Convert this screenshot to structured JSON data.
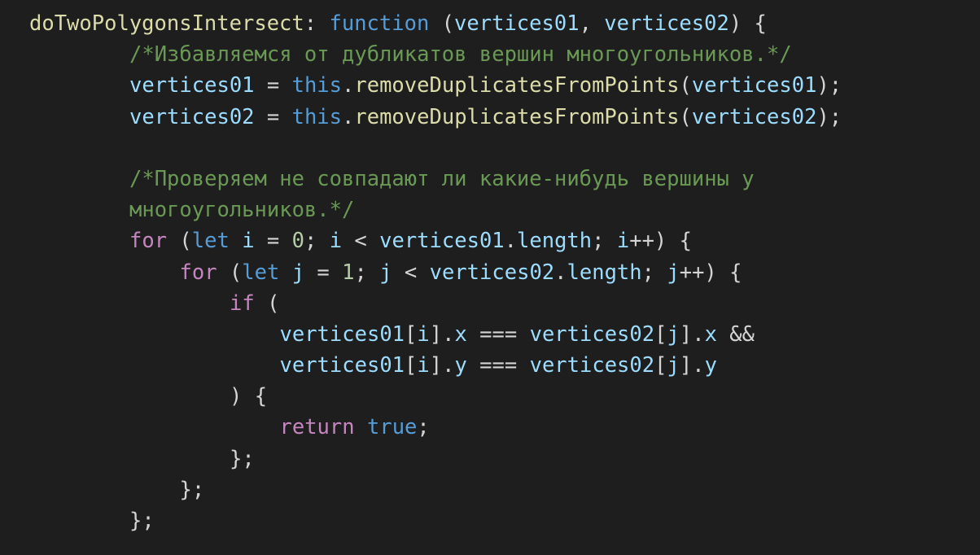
{
  "colors": {
    "background": "#1e1e1e",
    "default": "#d4d4d4",
    "keyword": "#569cd6",
    "control": "#c586c0",
    "variable": "#9cdcfe",
    "function": "#dcdcaa",
    "number": "#b5cea8",
    "comment": "#6a9955"
  },
  "lines": [
    {
      "indent": 0,
      "tokens": [
        {
          "t": "doTwoPolygonsIntersect",
          "k": "function"
        },
        {
          "t": ": ",
          "k": "default"
        },
        {
          "t": "function",
          "k": "keyword"
        },
        {
          "t": " (",
          "k": "default"
        },
        {
          "t": "vertices01",
          "k": "variable"
        },
        {
          "t": ", ",
          "k": "default"
        },
        {
          "t": "vertices02",
          "k": "variable"
        },
        {
          "t": ") {",
          "k": "default"
        }
      ]
    },
    {
      "indent": 2,
      "tokens": [
        {
          "t": "/*Избавляемся от дубликатов вершин многоугольников.*/",
          "k": "comment"
        }
      ]
    },
    {
      "indent": 2,
      "tokens": [
        {
          "t": "vertices01",
          "k": "variable"
        },
        {
          "t": " = ",
          "k": "default"
        },
        {
          "t": "this",
          "k": "keyword"
        },
        {
          "t": ".",
          "k": "default"
        },
        {
          "t": "removeDuplicatesFromPoints",
          "k": "function"
        },
        {
          "t": "(",
          "k": "default"
        },
        {
          "t": "vertices01",
          "k": "variable"
        },
        {
          "t": ");",
          "k": "default"
        }
      ]
    },
    {
      "indent": 2,
      "tokens": [
        {
          "t": "vertices02",
          "k": "variable"
        },
        {
          "t": " = ",
          "k": "default"
        },
        {
          "t": "this",
          "k": "keyword"
        },
        {
          "t": ".",
          "k": "default"
        },
        {
          "t": "removeDuplicatesFromPoints",
          "k": "function"
        },
        {
          "t": "(",
          "k": "default"
        },
        {
          "t": "vertices02",
          "k": "variable"
        },
        {
          "t": ");",
          "k": "default"
        }
      ]
    },
    {
      "indent": 0,
      "tokens": []
    },
    {
      "indent": 2,
      "tokens": [
        {
          "t": "/*Проверяем не совпадают ли какие-нибудь вершины у",
          "k": "comment"
        }
      ]
    },
    {
      "indent": 2,
      "tokens": [
        {
          "t": "многоугольников.*/",
          "k": "comment"
        }
      ]
    },
    {
      "indent": 2,
      "tokens": [
        {
          "t": "for",
          "k": "control"
        },
        {
          "t": " (",
          "k": "default"
        },
        {
          "t": "let",
          "k": "keyword"
        },
        {
          "t": " ",
          "k": "default"
        },
        {
          "t": "i",
          "k": "variable"
        },
        {
          "t": " = ",
          "k": "default"
        },
        {
          "t": "0",
          "k": "number"
        },
        {
          "t": "; ",
          "k": "default"
        },
        {
          "t": "i",
          "k": "variable"
        },
        {
          "t": " < ",
          "k": "default"
        },
        {
          "t": "vertices01",
          "k": "variable"
        },
        {
          "t": ".",
          "k": "default"
        },
        {
          "t": "length",
          "k": "variable"
        },
        {
          "t": "; ",
          "k": "default"
        },
        {
          "t": "i",
          "k": "variable"
        },
        {
          "t": "++) {",
          "k": "default"
        }
      ]
    },
    {
      "indent": 3,
      "tokens": [
        {
          "t": "for",
          "k": "control"
        },
        {
          "t": " (",
          "k": "default"
        },
        {
          "t": "let",
          "k": "keyword"
        },
        {
          "t": " ",
          "k": "default"
        },
        {
          "t": "j",
          "k": "variable"
        },
        {
          "t": " = ",
          "k": "default"
        },
        {
          "t": "1",
          "k": "number"
        },
        {
          "t": "; ",
          "k": "default"
        },
        {
          "t": "j",
          "k": "variable"
        },
        {
          "t": " < ",
          "k": "default"
        },
        {
          "t": "vertices02",
          "k": "variable"
        },
        {
          "t": ".",
          "k": "default"
        },
        {
          "t": "length",
          "k": "variable"
        },
        {
          "t": "; ",
          "k": "default"
        },
        {
          "t": "j",
          "k": "variable"
        },
        {
          "t": "++) {",
          "k": "default"
        }
      ]
    },
    {
      "indent": 4,
      "tokens": [
        {
          "t": "if",
          "k": "control"
        },
        {
          "t": " (",
          "k": "default"
        }
      ]
    },
    {
      "indent": 5,
      "tokens": [
        {
          "t": "vertices01",
          "k": "variable"
        },
        {
          "t": "[",
          "k": "default"
        },
        {
          "t": "i",
          "k": "variable"
        },
        {
          "t": "].",
          "k": "default"
        },
        {
          "t": "x",
          "k": "variable"
        },
        {
          "t": " === ",
          "k": "default"
        },
        {
          "t": "vertices02",
          "k": "variable"
        },
        {
          "t": "[",
          "k": "default"
        },
        {
          "t": "j",
          "k": "variable"
        },
        {
          "t": "].",
          "k": "default"
        },
        {
          "t": "x",
          "k": "variable"
        },
        {
          "t": " &&",
          "k": "default"
        }
      ]
    },
    {
      "indent": 5,
      "tokens": [
        {
          "t": "vertices01",
          "k": "variable"
        },
        {
          "t": "[",
          "k": "default"
        },
        {
          "t": "i",
          "k": "variable"
        },
        {
          "t": "].",
          "k": "default"
        },
        {
          "t": "y",
          "k": "variable"
        },
        {
          "t": " === ",
          "k": "default"
        },
        {
          "t": "vertices02",
          "k": "variable"
        },
        {
          "t": "[",
          "k": "default"
        },
        {
          "t": "j",
          "k": "variable"
        },
        {
          "t": "].",
          "k": "default"
        },
        {
          "t": "y",
          "k": "variable"
        }
      ]
    },
    {
      "indent": 4,
      "tokens": [
        {
          "t": ") {",
          "k": "default"
        }
      ]
    },
    {
      "indent": 5,
      "tokens": [
        {
          "t": "return",
          "k": "control"
        },
        {
          "t": " ",
          "k": "default"
        },
        {
          "t": "true",
          "k": "keyword"
        },
        {
          "t": ";",
          "k": "default"
        }
      ]
    },
    {
      "indent": 4,
      "tokens": [
        {
          "t": "};",
          "k": "default"
        }
      ]
    },
    {
      "indent": 3,
      "tokens": [
        {
          "t": "};",
          "k": "default"
        }
      ]
    },
    {
      "indent": 2,
      "tokens": [
        {
          "t": "};",
          "k": "default"
        }
      ]
    }
  ]
}
